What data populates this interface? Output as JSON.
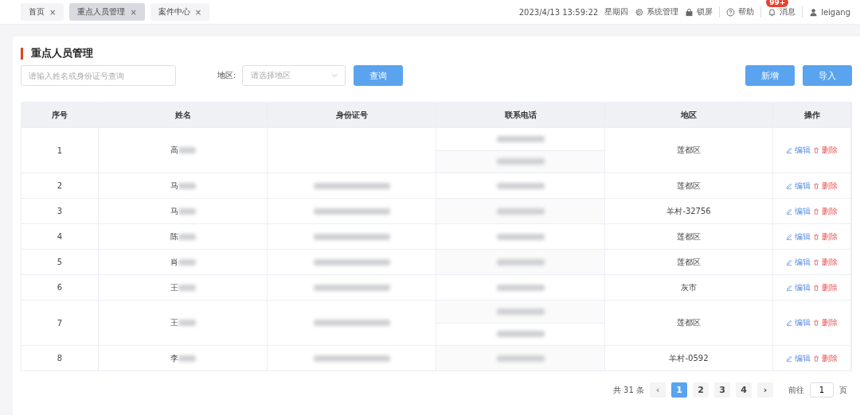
{
  "tabs": [
    {
      "label": "首页",
      "close": "×",
      "selected": false
    },
    {
      "label": "重点人员管理",
      "close": "×",
      "selected": true
    },
    {
      "label": "案件中心",
      "close": "×",
      "selected": false
    }
  ],
  "header": {
    "datetime": "2023/4/13 13:59:22",
    "weekday": "星期四",
    "actions": [
      {
        "kind": "gear",
        "label": "系统管理"
      },
      {
        "kind": "lock",
        "label": "锁屏"
      },
      {
        "kind": "help",
        "label": "帮助"
      },
      {
        "kind": "bell",
        "label": "消息",
        "badge": "99+"
      },
      {
        "kind": "user",
        "label": "leigang"
      }
    ]
  },
  "page": {
    "title": "重点人员管理",
    "search": {
      "placeholder": "请输入姓名或身份证号查询"
    },
    "region_label": "地区:",
    "region_select": {
      "placeholder": "请选择地区"
    },
    "query_button": "查询",
    "buttons": [
      "新增",
      "导入"
    ]
  },
  "table": {
    "columns": [
      "序号",
      "姓名",
      "身份证号",
      "联系电话",
      "地区",
      "操作"
    ],
    "rows": [
      {
        "index": "1",
        "surname": "高",
        "id_blurred": false,
        "phones": [
          {
            "kind": "blurred"
          },
          {
            "kind": "blurred"
          }
        ],
        "region": "莲都区",
        "edit": "编辑",
        "delete": "删除"
      },
      {
        "index": "2",
        "surname": "马",
        "id_blurred": true,
        "phones": [
          {
            "kind": "blurred"
          }
        ],
        "region": "莲都区",
        "edit": "编辑",
        "delete": "删除"
      },
      {
        "index": "3",
        "surname": "马",
        "id_blurred": true,
        "phones": [
          {
            "kind": "blurred"
          }
        ],
        "region": "羊村-32756",
        "edit": "编辑",
        "delete": "删除"
      },
      {
        "index": "4",
        "surname": "陈",
        "id_blurred": true,
        "phones": [
          {
            "kind": "blurred"
          }
        ],
        "region": "莲都区",
        "edit": "编辑",
        "delete": "删除"
      },
      {
        "index": "5",
        "surname": "肖",
        "id_blurred": true,
        "phones": [
          {
            "kind": "blurred"
          }
        ],
        "region": "莲都区",
        "edit": "编辑",
        "delete": "删除"
      },
      {
        "index": "6",
        "surname": "王",
        "id_blurred": true,
        "phones": [
          {
            "kind": "blurred"
          }
        ],
        "region": "灰市",
        "edit": "编辑",
        "delete": "删除"
      },
      {
        "index": "7",
        "surname": "王",
        "id_blurred": true,
        "phones": [
          {
            "kind": "blurred"
          },
          {
            "kind": "blurred"
          }
        ],
        "region": "莲都区",
        "edit": "编辑",
        "delete": "删除"
      },
      {
        "index": "8",
        "surname": "李",
        "id_blurred": true,
        "phones": [
          {
            "kind": "blurred"
          }
        ],
        "region": "羊村-0592",
        "edit": "编辑",
        "delete": "删除"
      }
    ]
  },
  "pagination": {
    "total": "共 31 条",
    "prev": "‹",
    "pages": [
      {
        "label": "1",
        "selected": true
      },
      {
        "label": "2",
        "selected": false
      },
      {
        "label": "3",
        "selected": false
      },
      {
        "label": "4",
        "selected": false
      }
    ],
    "next": "›",
    "goto_label": "前往",
    "goto_value": "1",
    "goto_suffix": "页"
  }
}
